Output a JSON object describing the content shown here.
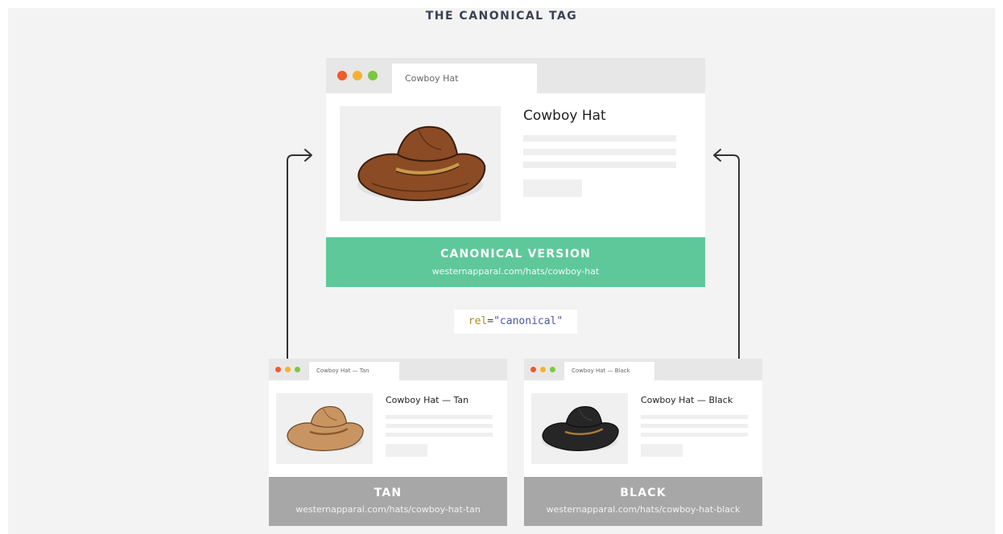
{
  "title": "THE CANONICAL TAG",
  "colors": {
    "canonical_banner": "#5ec89a",
    "variant_banner": "#a7a7a7",
    "dot_red": "#ef5a2c",
    "dot_yellow": "#f5b133",
    "dot_green": "#7cc73f",
    "hat_brown": "#8b4b24",
    "hat_tan": "#c89462",
    "hat_black": "#262626"
  },
  "canonical": {
    "tab_title": "Cowboy Hat",
    "product_title": "Cowboy Hat",
    "image_icon": "brown-cowboy-hat",
    "banner_label": "CANONICAL VERSION",
    "url": "westernapparal.com/hats/cowboy-hat"
  },
  "rel_tag": {
    "attr": "rel",
    "eq": "=",
    "value": "\"canonical\""
  },
  "variants": [
    {
      "tab_title": "Cowboy Hat — Tan",
      "product_title": "Cowboy Hat — Tan",
      "image_icon": "tan-cowboy-hat",
      "banner_label": "TAN",
      "url": "westernapparal.com/hats/cowboy-hat-tan"
    },
    {
      "tab_title": "Cowboy Hat — Black",
      "product_title": "Cowboy Hat — Black",
      "image_icon": "black-cowboy-hat",
      "banner_label": "BLACK",
      "url": "westernapparal.com/hats/cowboy-hat-black"
    }
  ]
}
